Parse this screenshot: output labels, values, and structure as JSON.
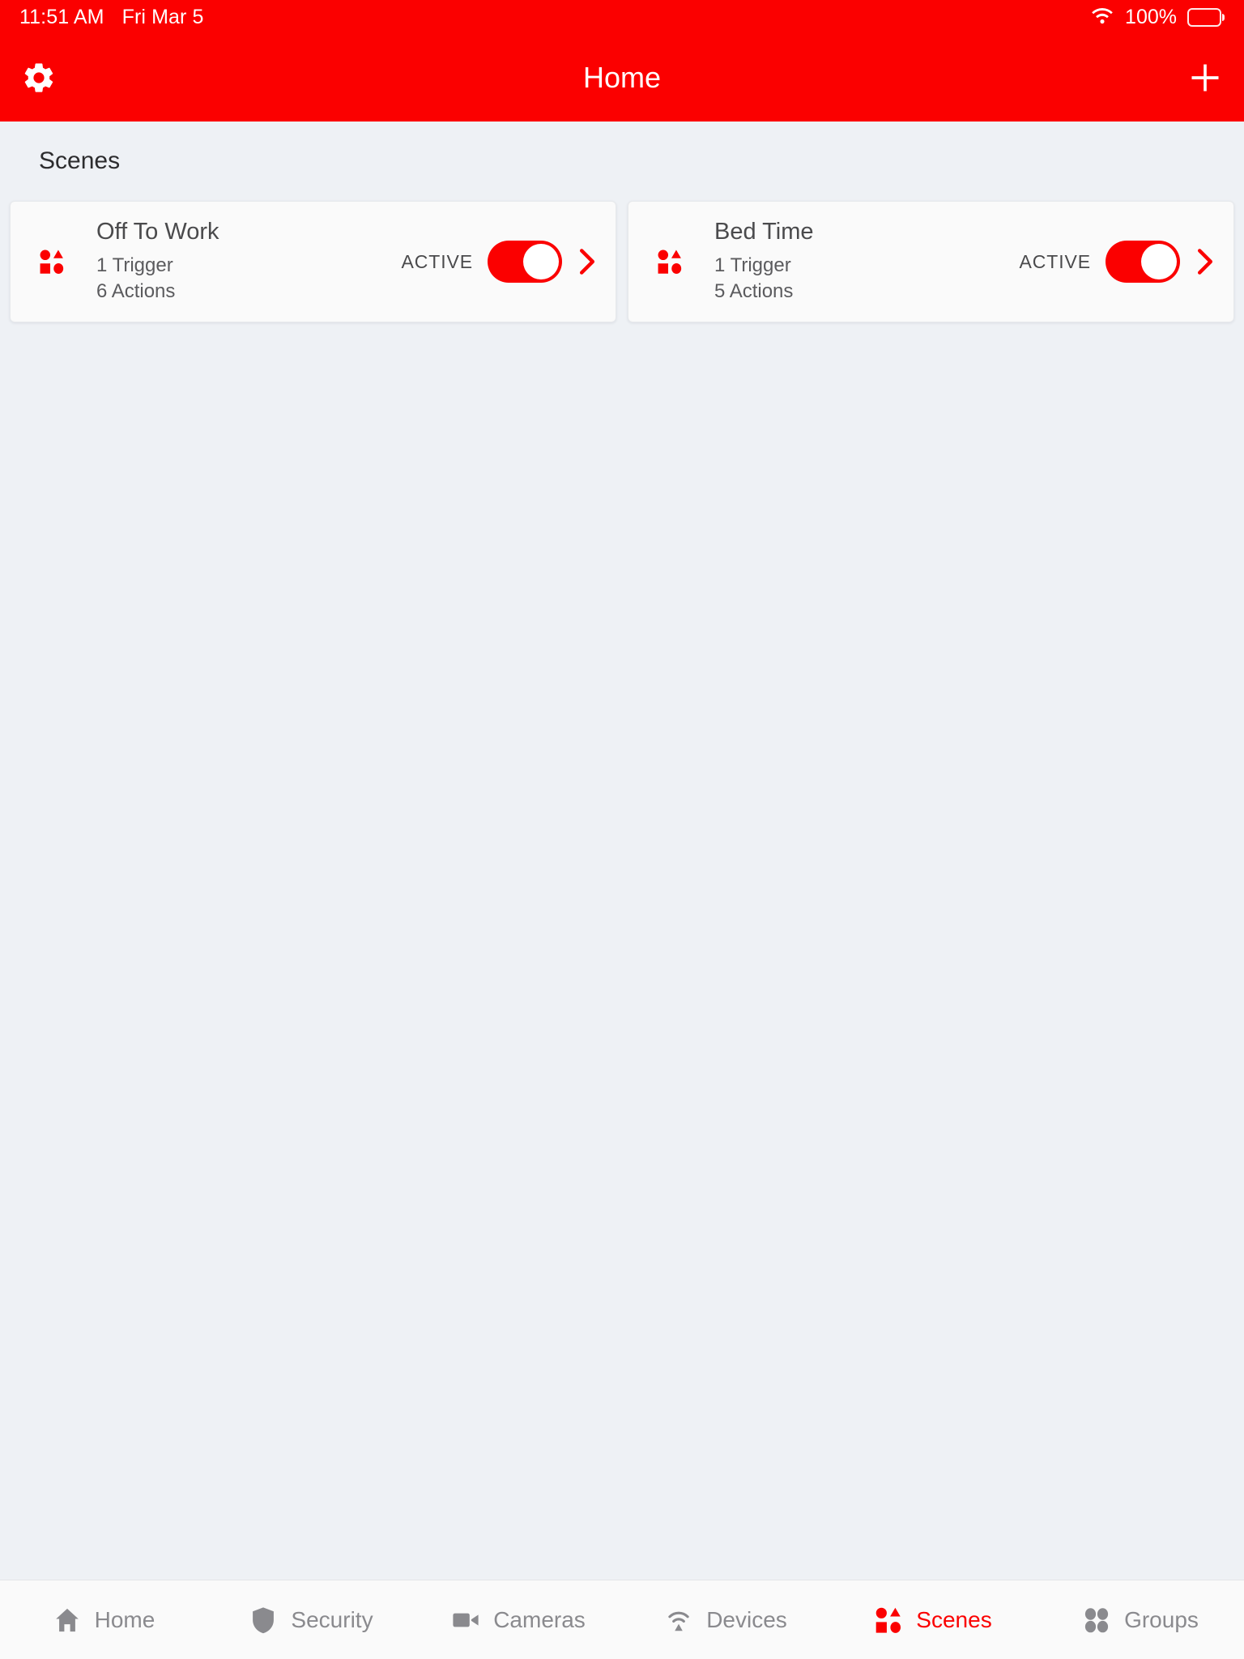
{
  "colors": {
    "accent": "#fb0000",
    "background": "#eef1f5",
    "card": "#fafafa",
    "inactive": "#8a8a8e"
  },
  "status_bar": {
    "time": "11:51 AM",
    "date": "Fri Mar 5",
    "battery_percent": "100%",
    "wifi_icon": "wifi-icon",
    "battery_icon": "battery-full-icon"
  },
  "nav_bar": {
    "title": "Home",
    "left_icon": "gear-icon",
    "right_icon": "plus-icon"
  },
  "main": {
    "section_title": "Scenes",
    "scenes": [
      {
        "name": "Off To Work",
        "triggers": "1 Trigger",
        "actions": "6 Actions",
        "state_label": "ACTIVE",
        "toggle_on": true,
        "icon": "scenes-shapes-icon",
        "chevron": "chevron-right-icon"
      },
      {
        "name": "Bed Time",
        "triggers": "1 Trigger",
        "actions": "5 Actions",
        "state_label": "ACTIVE",
        "toggle_on": true,
        "icon": "scenes-shapes-icon",
        "chevron": "chevron-right-icon"
      }
    ]
  },
  "tab_bar": {
    "items": [
      {
        "label": "Home",
        "icon": "house-icon",
        "active": false
      },
      {
        "label": "Security",
        "icon": "shield-icon",
        "active": false
      },
      {
        "label": "Cameras",
        "icon": "video-camera-icon",
        "active": false
      },
      {
        "label": "Devices",
        "icon": "wifi-signal-icon",
        "active": false
      },
      {
        "label": "Scenes",
        "icon": "scenes-shapes-icon",
        "active": true
      },
      {
        "label": "Groups",
        "icon": "groups-dots-icon",
        "active": false
      }
    ]
  }
}
